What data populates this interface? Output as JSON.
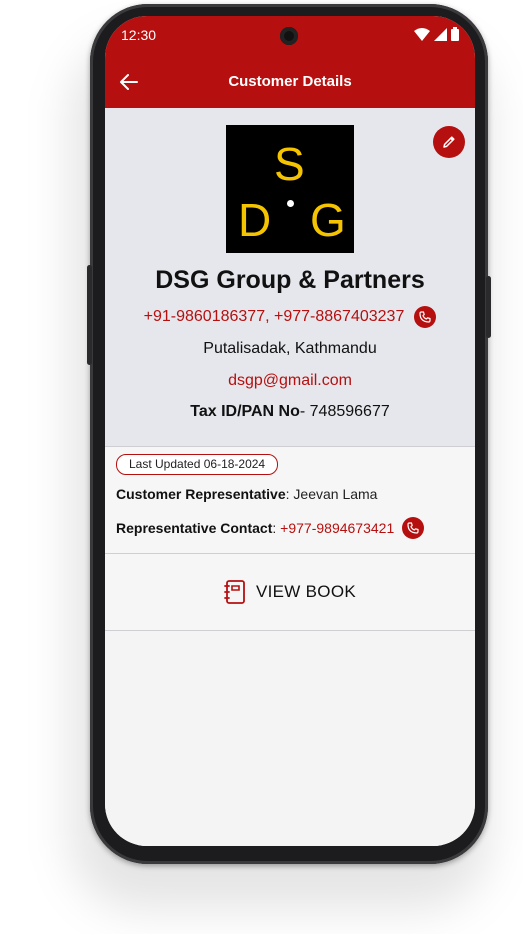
{
  "status_bar": {
    "time": "12:30"
  },
  "app_bar": {
    "title": "Customer Details"
  },
  "customer": {
    "logo_letters": {
      "top": "S",
      "left": "D",
      "right": "G"
    },
    "name": "DSG Group & Partners",
    "phones": "+91-9860186377, +977-8867403237",
    "address": "Putalisadak, Kathmandu",
    "email": "dsgp@gmail.com",
    "tax_label": "Tax ID/PAN No",
    "tax_separator": "- ",
    "tax_value": "748596677"
  },
  "info": {
    "last_updated": "Last Updated 06-18-2024",
    "rep_label": "Customer Representative",
    "rep_value": "Jeevan Lama",
    "contact_label": "Representative Contact",
    "contact_value": "+977-9894673421",
    "separator": ": "
  },
  "actions": {
    "view_book_label": "VIEW BOOK"
  },
  "colors": {
    "brand": "#b5100f",
    "logo_bg": "#000000",
    "logo_letters": "#f5c400"
  },
  "icons": {
    "back": "arrow-left-icon",
    "edit": "pencil-icon",
    "call": "phone-icon",
    "book": "notebook-icon"
  }
}
